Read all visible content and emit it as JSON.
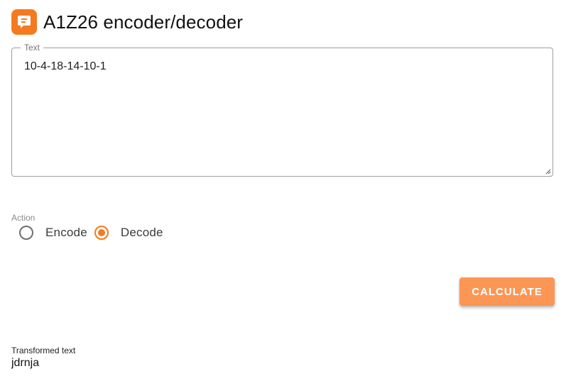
{
  "header": {
    "title": "A1Z26 encoder/decoder",
    "logo_icon": "chat-bubble-icon",
    "brand_color": "#f47a20"
  },
  "text_field": {
    "label": "Text",
    "value": "10-4-18-14-10-1"
  },
  "action": {
    "label": "Action",
    "options": [
      {
        "label": "Encode",
        "selected": false
      },
      {
        "label": "Decode",
        "selected": true
      }
    ]
  },
  "calculate_button": {
    "label": "CALCULATE",
    "color": "#fb9655"
  },
  "result": {
    "label": "Transformed text",
    "value": "jdrnja"
  }
}
